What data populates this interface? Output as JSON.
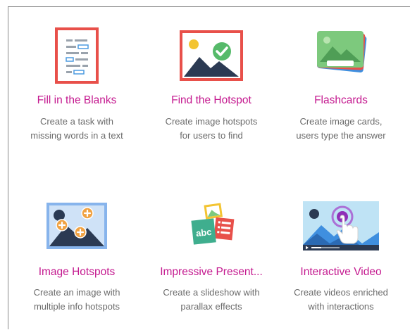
{
  "tiles": [
    {
      "title": "Fill in the Blanks",
      "desc": [
        "Create a task with",
        "missing words in a text"
      ],
      "icon": "fill-blanks-icon"
    },
    {
      "title": "Find the Hotspot",
      "desc": [
        "Create image hotspots",
        "for users to find"
      ],
      "icon": "hotspot-image-icon"
    },
    {
      "title": "Flashcards",
      "desc": [
        "Create image cards,",
        "users type the answer"
      ],
      "icon": "flashcards-icon"
    },
    {
      "title": "Image Hotspots",
      "desc": [
        "Create an image with",
        "multiple info hotspots"
      ],
      "icon": "image-hotspots-icon"
    },
    {
      "title": "Impressive Present...",
      "desc": [
        "Create a slideshow with",
        "parallax effects"
      ],
      "icon": "presentation-icon",
      "icon_text": "abc"
    },
    {
      "title": "Interactive Video",
      "desc": [
        "Create videos enriched",
        "with interactions"
      ],
      "icon": "interactive-video-icon"
    }
  ],
  "colors": {
    "title": "#c4198f",
    "desc": "#6b6b6b",
    "red": "#e8504a",
    "navy": "#2b3a53",
    "green": "#56ba6a",
    "orange": "#f0a243",
    "blue": "#3f8fdf"
  }
}
